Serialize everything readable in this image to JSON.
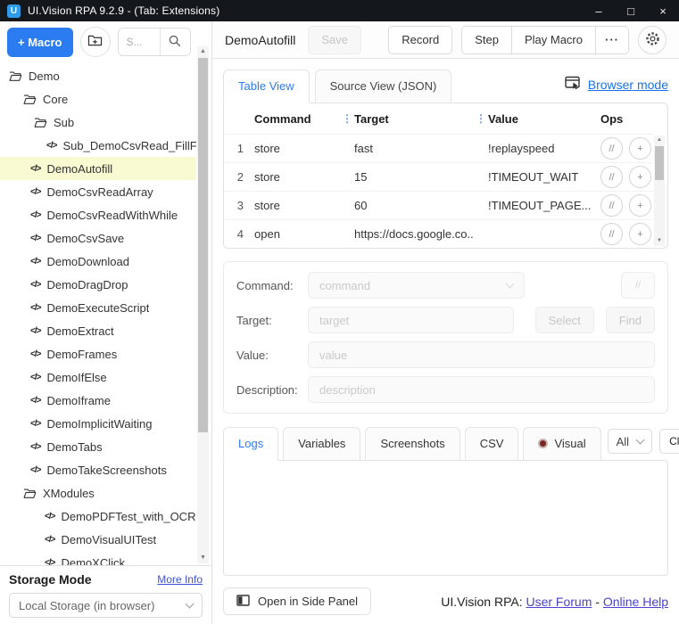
{
  "titlebar": {
    "title": "UI.Vision RPA 9.2.9 - (Tab: Extensions)",
    "logo_letter": "U",
    "minimize": "–",
    "maximize": "□",
    "close": "×"
  },
  "sidebar": {
    "macro_button": "+ Macro",
    "search_placeholder": "S...",
    "tree": [
      {
        "label": "Demo",
        "type": "folder",
        "level": 0
      },
      {
        "label": "Core",
        "type": "folder",
        "level": 1
      },
      {
        "label": "Sub",
        "type": "folder",
        "level": 2
      },
      {
        "label": "Sub_DemoCsvRead_FillFor",
        "type": "macro",
        "level": 3
      },
      {
        "label": "DemoAutofill",
        "type": "macro",
        "level": 1,
        "selected": true
      },
      {
        "label": "DemoCsvReadArray",
        "type": "macro",
        "level": 1
      },
      {
        "label": "DemoCsvReadWithWhile",
        "type": "macro",
        "level": 1
      },
      {
        "label": "DemoCsvSave",
        "type": "macro",
        "level": 1
      },
      {
        "label": "DemoDownload",
        "type": "macro",
        "level": 1
      },
      {
        "label": "DemoDragDrop",
        "type": "macro",
        "level": 1
      },
      {
        "label": "DemoExecuteScript",
        "type": "macro",
        "level": 1
      },
      {
        "label": "DemoExtract",
        "type": "macro",
        "level": 1
      },
      {
        "label": "DemoFrames",
        "type": "macro",
        "level": 1
      },
      {
        "label": "DemoIfElse",
        "type": "macro",
        "level": 1
      },
      {
        "label": "DemoIframe",
        "type": "macro",
        "level": 1
      },
      {
        "label": "DemoImplicitWaiting",
        "type": "macro",
        "level": 1
      },
      {
        "label": "DemoTabs",
        "type": "macro",
        "level": 1
      },
      {
        "label": "DemoTakeScreenshots",
        "type": "macro",
        "level": 1
      },
      {
        "label": "XModules",
        "type": "folder",
        "level": 1
      },
      {
        "label": "DemoPDFTest_with_OCR",
        "type": "macro",
        "level": 2
      },
      {
        "label": "DemoVisualUITest",
        "type": "macro",
        "level": 2
      },
      {
        "label": "DemoXClick",
        "type": "macro",
        "level": 2
      }
    ],
    "storage": {
      "title": "Storage Mode",
      "more_info": "More Info",
      "selected_option": "Local Storage (in browser)"
    }
  },
  "header": {
    "macro_name": "DemoAutofill",
    "save_label": "Save",
    "record_label": "Record",
    "step_label": "Step",
    "play_label": "Play Macro",
    "more_label": "···"
  },
  "editor": {
    "tabs": [
      {
        "label": "Table View",
        "active": true
      },
      {
        "label": "Source View (JSON)",
        "active": false
      }
    ],
    "browser_mode_label": "Browser mode",
    "table": {
      "columns": {
        "command": "Command",
        "target": "Target",
        "value": "Value",
        "ops": "Ops"
      },
      "rows": [
        {
          "num": "1",
          "command": "store",
          "target": "fast",
          "value": "!replayspeed"
        },
        {
          "num": "2",
          "command": "store",
          "target": "15",
          "value": "!TIMEOUT_WAIT"
        },
        {
          "num": "3",
          "command": "store",
          "target": "60",
          "value": "!TIMEOUT_PAGE..."
        },
        {
          "num": "4",
          "command": "open",
          "target": "https://docs.google.co...",
          "value": ""
        }
      ],
      "ops_buttons": [
        {
          "label": "//",
          "name": "toggle-comment-button"
        },
        {
          "label": "+",
          "name": "add-row-button"
        }
      ]
    },
    "form": {
      "command_label": "Command:",
      "command_placeholder": "command",
      "target_label": "Target:",
      "target_placeholder": "target",
      "select_button": "Select",
      "find_button": "Find",
      "value_label": "Value:",
      "value_placeholder": "value",
      "description_label": "Description:",
      "description_placeholder": "description",
      "comment_button": "//"
    }
  },
  "logs": {
    "tabs": [
      {
        "label": "Logs",
        "active": true
      },
      {
        "label": "Variables"
      },
      {
        "label": "Screenshots"
      },
      {
        "label": "CSV"
      },
      {
        "label": "Visual",
        "icon": "record-dot-icon"
      }
    ],
    "filter_value": "All",
    "clear_button": "Clear"
  },
  "footer": {
    "side_panel_button": "Open in Side Panel",
    "brand": "UI.Vision RPA:",
    "user_forum": "User Forum",
    "separator": "-",
    "online_help": "Online Help"
  },
  "glyphs": {
    "code_icon": "</>",
    "scroll_up": "▲",
    "scroll_down": "▼"
  },
  "colors": {
    "accent_blue": "#2a7cf0",
    "link_blue": "#1a73e8",
    "link_indigo": "#4a43cc",
    "selected_row_bg": "#fafad2",
    "titlebar_bg": "#14181d",
    "visual_dot": "#7a2823"
  }
}
